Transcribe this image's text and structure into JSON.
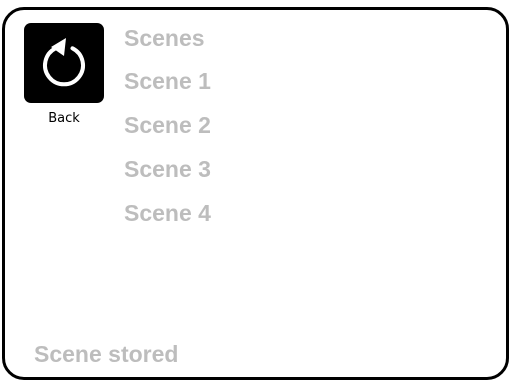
{
  "back": {
    "label": "Back",
    "icon": "undo-arrow-icon"
  },
  "menu": {
    "title": "Scenes",
    "items": [
      {
        "label": "Scene 1"
      },
      {
        "label": "Scene 2"
      },
      {
        "label": "Scene 3"
      },
      {
        "label": "Scene 4"
      }
    ]
  },
  "status": {
    "text": "Scene stored"
  },
  "colors": {
    "border": "#000000",
    "text_muted": "#bdbdbd",
    "button_bg": "#000000",
    "icon_fg": "#ffffff"
  }
}
